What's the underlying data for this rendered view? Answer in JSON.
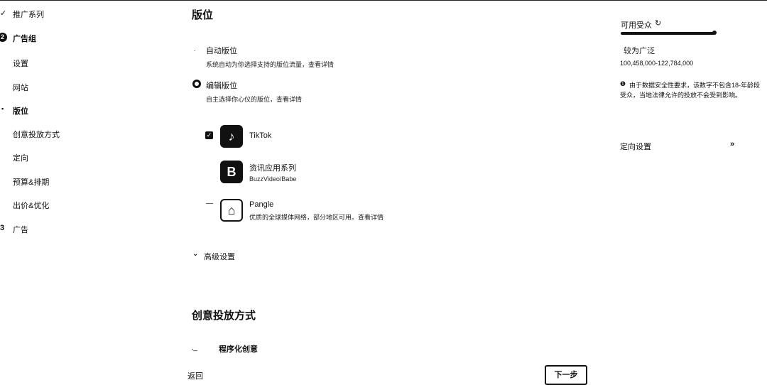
{
  "nav": {
    "step1_mark": "✓",
    "step1_label": "推广系列",
    "step2_mark": "2",
    "step2_label": "广告组",
    "sub": [
      "设置",
      "网站",
      "版位",
      "创意投放方式",
      "定向",
      "预算&排期",
      "出价&优化"
    ],
    "active_mark": "▪",
    "step3_mark": "3",
    "step3_label": "广告"
  },
  "placement": {
    "title": "版位",
    "auto_label": "自动版位",
    "auto_desc": "系统自动为你选择支持的版位流量，查看详情",
    "edit_label": "编辑版位",
    "edit_desc": "自主选择你心仪的版位，查看详情",
    "apps": [
      {
        "name": "TikTok",
        "desc": "",
        "icon": "tiktok-icon",
        "glyph": "♪"
      },
      {
        "name": "资讯应用系列",
        "desc": "BuzzVideo/Babe",
        "icon": "news-apps-icon",
        "glyph": "B"
      },
      {
        "name": "Pangle",
        "desc": "优质的全球媒体网络，部分地区可用。查看详情",
        "icon": "pangle-icon",
        "glyph": "⌂"
      }
    ],
    "pangle_dash": "—",
    "advanced": "高级设置"
  },
  "creative": {
    "title": "创意投放方式",
    "programmatic_label": "程序化创意"
  },
  "footer": {
    "back": "返回",
    "next": "下一步"
  },
  "audience": {
    "title": "可用受众",
    "title_icon": "refresh-icon",
    "level": "较为广泛",
    "range": "100,458,000-122,784,000",
    "note": "由于数据安全性要求，该数字不包含18-年龄段受众，当地法律允许的投放不会受到影响。",
    "targeting": "定向设置"
  }
}
